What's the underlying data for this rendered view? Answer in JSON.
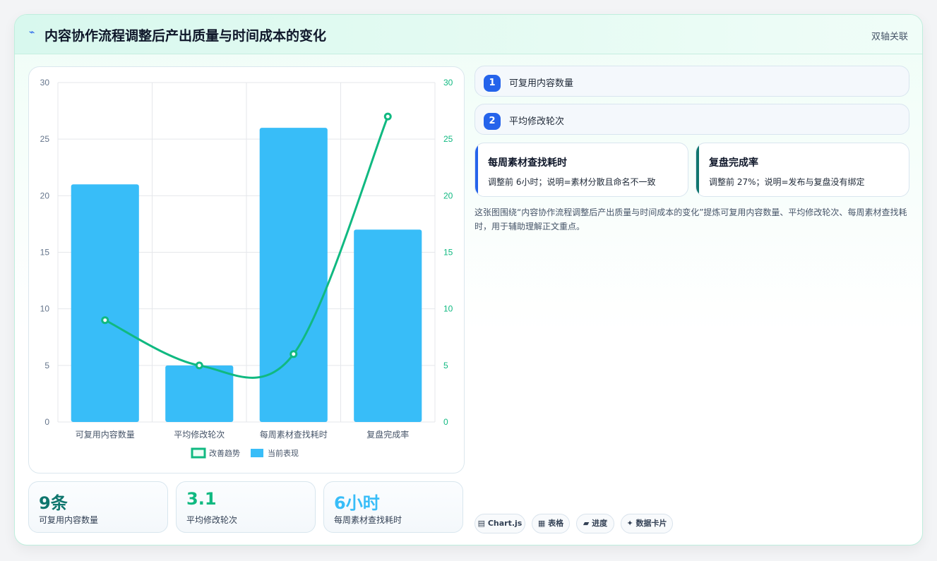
{
  "header": {
    "title": "内容协作流程调整后产出质量与时间成本的变化",
    "tag": "双轴关联"
  },
  "chart_data": {
    "type": "bar",
    "categories": [
      "可复用内容数量",
      "平均修改轮次",
      "每周素材查找耗时",
      "复盘完成率"
    ],
    "series": [
      {
        "name": "当前表现",
        "type": "bar",
        "values": [
          21,
          5,
          26,
          17
        ],
        "color": "#38bdf8",
        "axis": "left"
      },
      {
        "name": "改善趋势",
        "type": "line",
        "values": [
          9,
          5,
          6,
          27
        ],
        "color": "#10b981",
        "axis": "right"
      }
    ],
    "ylim_left": [
      0,
      30
    ],
    "ylim_right": [
      0,
      30
    ],
    "yticks": [
      "0",
      "5",
      "10",
      "15",
      "20",
      "25",
      "30"
    ],
    "legend_position": "bottom",
    "grid": true
  },
  "stats": [
    {
      "value": "9条",
      "label": "可复用内容数量",
      "color": "#0f766e"
    },
    {
      "value": "3.1",
      "label": "平均修改轮次",
      "color": "#10b981"
    },
    {
      "value": "6小时",
      "label": "每周素材查找耗时",
      "color": "#38bdf8"
    }
  ],
  "legend_items": [
    {
      "num": "1",
      "label": "可复用内容数量"
    },
    {
      "num": "2",
      "label": "平均修改轮次"
    }
  ],
  "notes": [
    {
      "title": "每周素材查找耗时",
      "body": "调整前 6小时；说明=素材分散且命名不一致",
      "accent": "#2563eb"
    },
    {
      "title": "复盘完成率",
      "body": "调整前 27%；说明=发布与复盘没有绑定",
      "accent": "#0f766e"
    }
  ],
  "description": "这张图围绕“内容协作流程调整后产出质量与时间成本的变化”提炼可复用内容数量、平均修改轮次、每周素材查找耗时，用于辅助理解正文重点。",
  "chips": [
    {
      "label": "▤ Chart.js"
    },
    {
      "label": "▦ 表格"
    },
    {
      "label": "▰ 进度"
    },
    {
      "label": "✦ 数据卡片"
    }
  ]
}
